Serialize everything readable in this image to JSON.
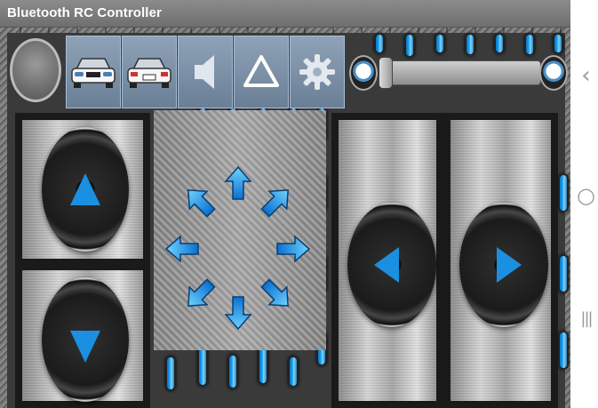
{
  "title": "Bluetooth RC Controller",
  "toolbar": {
    "items": [
      {
        "name": "connect-button",
        "icon": "circle-icon"
      },
      {
        "name": "front-lights-button",
        "icon": "car-front-icon"
      },
      {
        "name": "back-lights-button",
        "icon": "car-back-icon"
      },
      {
        "name": "horn-button",
        "icon": "speaker-icon"
      },
      {
        "name": "hazard-button",
        "icon": "triangle-icon"
      },
      {
        "name": "settings-button",
        "icon": "gear-icon"
      }
    ]
  },
  "speed_slider": {
    "value": 0
  },
  "colors": {
    "accent": "#1aa8ff",
    "panel_border": "#1a1a1a",
    "titlebar": "#7a7a7a"
  },
  "controls": {
    "left_up": "triangle-up-icon",
    "left_down": "triangle-down-icon",
    "right_left": "triangle-left-icon",
    "right_right": "triangle-right-icon"
  },
  "android_nav": {
    "back": "‹",
    "home": "○",
    "recents": "|||"
  }
}
